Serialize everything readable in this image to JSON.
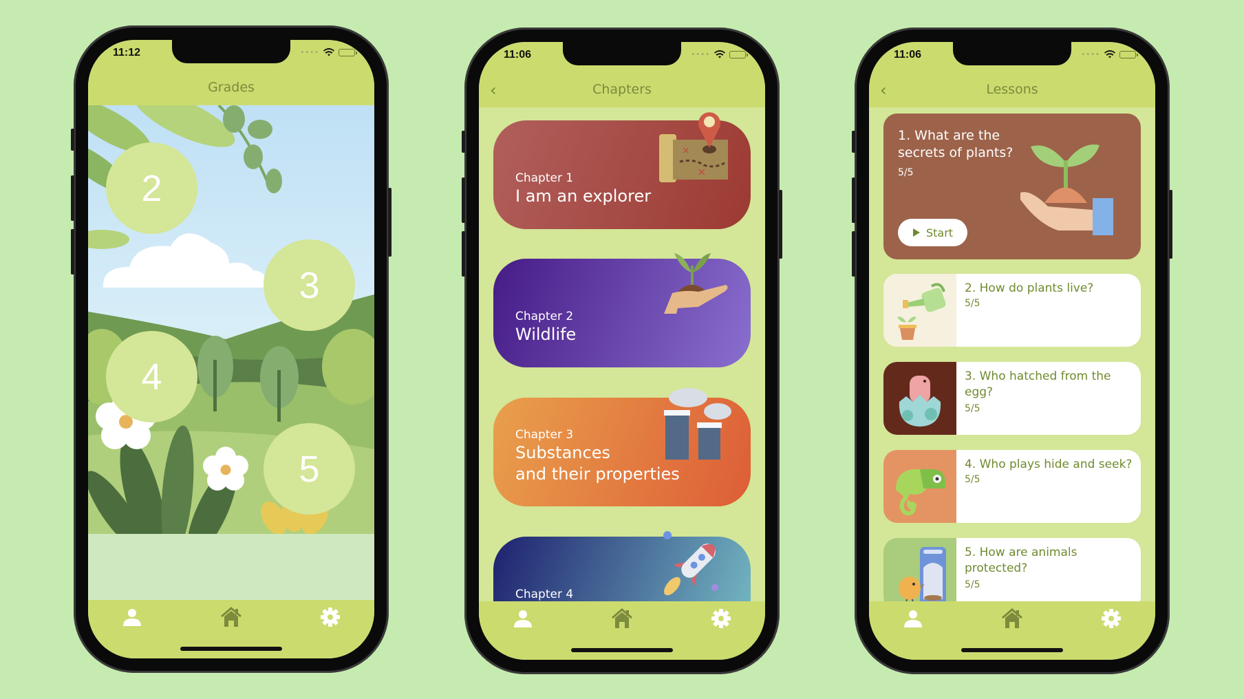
{
  "colors": {
    "page_bg": "#c6ebb0",
    "bar_bg": "#ccdb6e",
    "content_bg": "#d4e697",
    "accent_text": "#6f8a2e",
    "nav_title": "#7b8b3c"
  },
  "tabbar": {
    "items": [
      {
        "icon": "person-icon",
        "label": "Profile"
      },
      {
        "icon": "home-icon",
        "label": "Home",
        "active": true
      },
      {
        "icon": "gear-icon",
        "label": "Settings"
      }
    ]
  },
  "screens": {
    "grades": {
      "time": "11:12",
      "title": "Grades",
      "grades": [
        "2",
        "3",
        "4",
        "5"
      ]
    },
    "chapters": {
      "time": "11:06",
      "title": "Chapters",
      "back_icon": "chevron-left-icon",
      "items": [
        {
          "label": "Chapter 1",
          "title": "I am an explorer",
          "icon": "treasure-map-icon",
          "colors": [
            "#b15f5c",
            "#9c3a32"
          ]
        },
        {
          "label": "Chapter 2",
          "title": "Wildlife",
          "icon": "plant-in-hand-icon",
          "colors": [
            "#461b86",
            "#8a6fcf"
          ]
        },
        {
          "label": "Chapter 3",
          "title_line1": "Substances",
          "title_line2": "and their properties",
          "icon": "factory-icon",
          "colors": [
            "#e9a04c",
            "#dd5d37"
          ]
        },
        {
          "label": "Chapter 4",
          "title": "",
          "icon": "rocket-icon",
          "colors": [
            "#1e216f",
            "#76bcc5"
          ]
        }
      ]
    },
    "lessons": {
      "time": "11:06",
      "title": "Lessons",
      "back_icon": "chevron-left-icon",
      "featured": {
        "title": "1. What are the secrets of plants?",
        "progress": "5/5",
        "start_label": "Start",
        "icon": "sprout-in-hand-icon"
      },
      "items": [
        {
          "title": "2. How do plants live?",
          "progress": "5/5",
          "icon": "watering-can-icon",
          "thumb_bg": "#f6f0df"
        },
        {
          "title": "3. Who hatched from the egg?",
          "progress": "5/5",
          "icon": "dinosaur-egg-icon",
          "thumb_bg": "#632a1c"
        },
        {
          "title": "4. Who plays hide and seek?",
          "progress": "5/5",
          "icon": "chameleon-icon",
          "thumb_bg": "#e39462"
        },
        {
          "title": "5. How are animals protected?",
          "progress": "5/5",
          "icon": "bird-feeder-icon",
          "thumb_bg": "#a9cc7d"
        }
      ]
    }
  }
}
